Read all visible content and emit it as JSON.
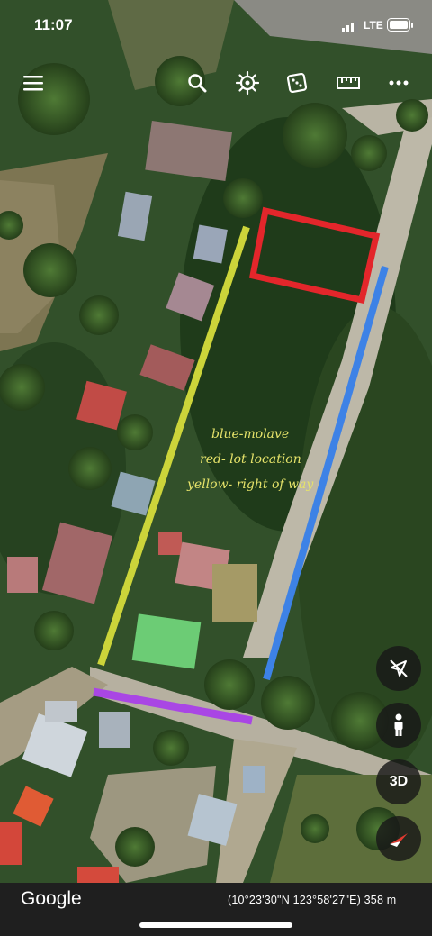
{
  "status_bar": {
    "time": "11:07",
    "network": "LTE",
    "icons": [
      "signal-bars-icon",
      "battery-icon"
    ]
  },
  "toolbar": {
    "icons": [
      "menu-icon",
      "search-icon",
      "voyager-icon",
      "dice-icon",
      "ruler-icon",
      "more-icon"
    ]
  },
  "annotations": {
    "lines": [
      "blue-molave",
      "red- lot location",
      "yellow- right of way"
    ],
    "colors": {
      "blue": "#3d82e6",
      "red": "#e3262b",
      "yellow": "#ccd43a",
      "purple": "#a946e4",
      "text": "#e6e36a"
    }
  },
  "controls": {
    "location_off_icon": "location-off-icon",
    "pegman_icon": "pegman-icon",
    "threed_label": "3D",
    "compass_icon": "compass-icon"
  },
  "footer": {
    "logo": "Google",
    "coordinates": "(10°23'30\"N 123°58'27\"E) 358 m"
  }
}
